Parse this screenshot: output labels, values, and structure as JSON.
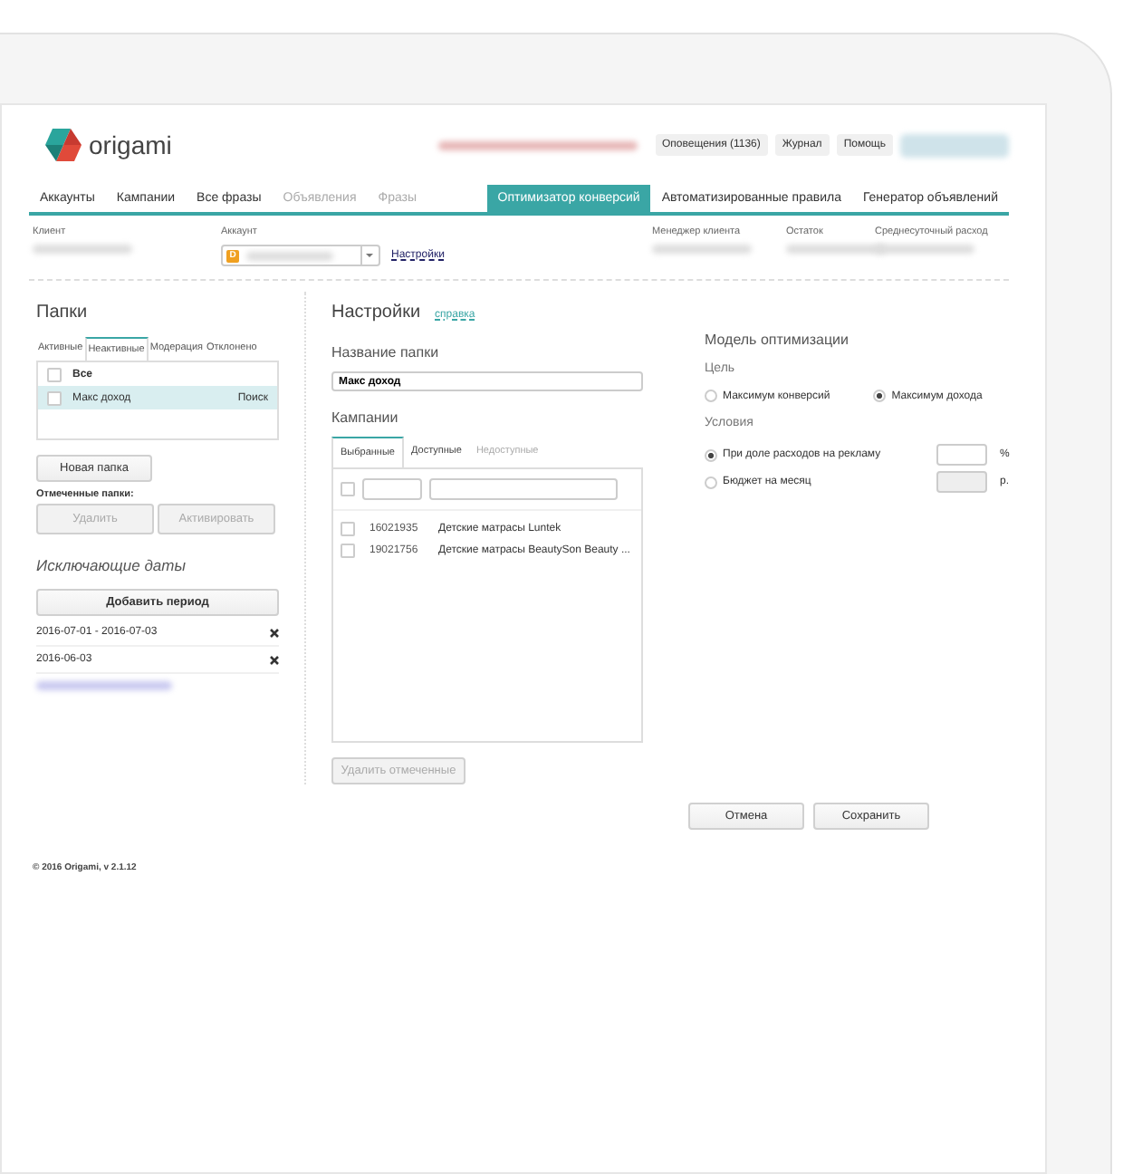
{
  "header": {
    "logo_text": "origami",
    "buttons": [
      {
        "label": "Оповещения (1136)"
      },
      {
        "label": "Журнал"
      },
      {
        "label": "Помощь"
      }
    ]
  },
  "nav": [
    {
      "label": "Аккаунты",
      "selected": false,
      "disabled": false
    },
    {
      "label": "Кампании",
      "selected": false,
      "disabled": false
    },
    {
      "label": "Все фразы",
      "selected": false,
      "disabled": false
    },
    {
      "label": "Объявления",
      "selected": false,
      "disabled": true
    },
    {
      "label": "Фразы",
      "selected": false,
      "disabled": true
    },
    {
      "label": "Оптимизатор конверсий",
      "selected": true,
      "disabled": false
    },
    {
      "label": "Автоматизированные правила",
      "selected": false,
      "disabled": false
    },
    {
      "label": "Генератор объявлений",
      "selected": false,
      "disabled": false
    }
  ],
  "account_bar": {
    "client_label": "Клиент",
    "account_label": "Аккаунт",
    "account_icon_letter": "D",
    "settings_link": "Настройки",
    "manager_label": "Менеджер клиента",
    "balance_label": "Остаток",
    "daily_label": "Среднесуточный расход"
  },
  "folders": {
    "title": "Папки",
    "tabs": [
      {
        "label": "Активные",
        "selected": false
      },
      {
        "label": "Неактивные",
        "selected": true
      },
      {
        "label": "Модерация",
        "selected": false
      },
      {
        "label": "Отклонено",
        "selected": false
      }
    ],
    "all_label": "Все",
    "all_checked": false,
    "items": [
      {
        "name": "Макс доход",
        "tag": "Поиск",
        "checked": false,
        "selected": true
      }
    ],
    "new_button": "Новая папка",
    "marked_label": "Отмеченные папки:",
    "marked_buttons": [
      {
        "label": "Удалить",
        "disabled": true
      },
      {
        "label": "Активировать",
        "disabled": true
      }
    ]
  },
  "excluded_dates": {
    "title": "Исключающие даты",
    "add_button": "Добавить период",
    "dates": [
      "2016-07-01 - 2016-07-03",
      "2016-06-03"
    ]
  },
  "settings": {
    "title": "Настройки",
    "help_link": "справка",
    "name_label": "Название папки",
    "name_value": "Макс доход",
    "campaigns_label": "Кампании",
    "tabs": [
      {
        "label": "Выбранные",
        "selected": true,
        "disabled": false
      },
      {
        "label": "Доступные",
        "selected": false,
        "disabled": false
      },
      {
        "label": "Недоступные",
        "selected": false,
        "disabled": true
      }
    ],
    "select_all_checked": false,
    "rows": [
      {
        "id": "16021935",
        "name": "Детские матрасы Luntek",
        "checked": false
      },
      {
        "id": "19021756",
        "name": "Детские матрасы BeautySon Beauty ...",
        "checked": false
      }
    ],
    "delete_button": {
      "label": "Удалить отмеченные",
      "disabled": true
    }
  },
  "model": {
    "title": "Модель оптимизации",
    "goal_label": "Цель",
    "goals": [
      {
        "label": "Максимум конверсий",
        "selected": false
      },
      {
        "label": "Максимум дохода",
        "selected": true
      }
    ],
    "conditions_label": "Условия",
    "conditions": [
      {
        "label": "При доле расходов на рекламу",
        "selected": true,
        "unit": "%"
      },
      {
        "label": "Бюджет на месяц",
        "selected": false,
        "unit": "р."
      }
    ]
  },
  "actions": [
    "Отмена",
    "Сохранить"
  ],
  "footer": "© 2016 Origami, v 2.1.12"
}
